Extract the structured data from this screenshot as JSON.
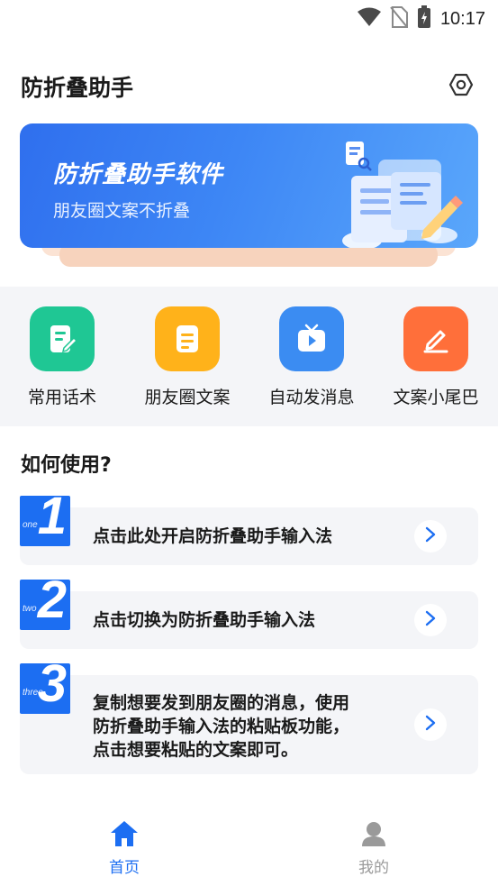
{
  "status_bar": {
    "time": "10:17"
  },
  "header": {
    "title": "防折叠助手",
    "settings_icon": "settings-hexagon-icon"
  },
  "banner": {
    "title": "防折叠助手软件",
    "subtitle": "朋友圈文案不折叠"
  },
  "features": [
    {
      "label": "常用话术",
      "icon": "note-edit-icon",
      "color": "#1fc794"
    },
    {
      "label": "朋友圈文案",
      "icon": "document-icon",
      "color": "#ffb21a"
    },
    {
      "label": "自动发消息",
      "icon": "tv-play-icon",
      "color": "#3b8cf2"
    },
    {
      "label": "文案小尾巴",
      "icon": "pen-icon",
      "color": "#ff6f3a"
    }
  ],
  "howto": {
    "title": "如何使用?",
    "steps": [
      {
        "word": "one",
        "number": "1",
        "text": "点击此处开启防折叠助手输入法"
      },
      {
        "word": "two",
        "number": "2",
        "text": "点击切换为防折叠助手输入法"
      },
      {
        "word": "three",
        "number": "3",
        "line1": "复制想要发到朋友圈的消息，使用",
        "line2": "防折叠助手输入法的粘贴板功能，",
        "line3": "点击想要粘贴的文案即可。"
      }
    ]
  },
  "nav": {
    "home": {
      "label": "首页",
      "active": true
    },
    "mine": {
      "label": "我的",
      "active": false
    }
  },
  "colors": {
    "accent": "#1c6ef2",
    "inactive": "#9a9a9a"
  }
}
